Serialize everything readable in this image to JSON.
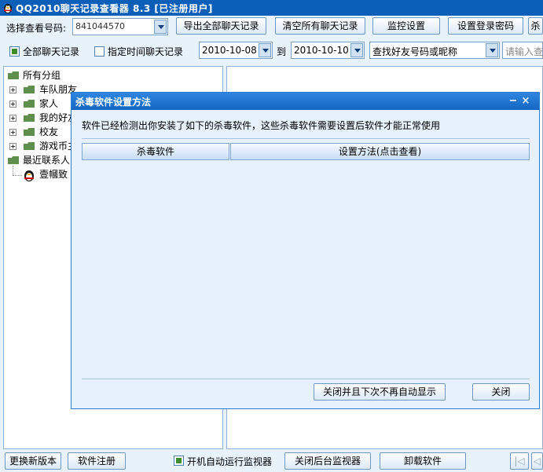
{
  "window": {
    "title": "QQ2010聊天记录查看器 8.3 [已注册用户]",
    "icon": "qq-penguin-icon"
  },
  "toolbar": {
    "account_label": "选择查看号码:",
    "account_value": "841044570",
    "export_all_label": "导出全部聊天记录",
    "clear_all_label": "清空所有聊天记录",
    "monitor_settings_label": "监控设置",
    "set_password_label": "设置登录密码",
    "cutoff_label": "杀"
  },
  "filters": {
    "all_records_label": "全部聊天记录",
    "time_range_label": "指定时间聊天记录",
    "date_from": "2010-10-08",
    "to_label": "到",
    "date_to": "2010-10-10",
    "search_type": "查找好友号码或昵称",
    "search_placeholder": "请输入查"
  },
  "tree": {
    "root_label": "所有分组",
    "groups": [
      {
        "label": "车队朋友"
      },
      {
        "label": "家人"
      },
      {
        "label": "我的好友"
      },
      {
        "label": "校友"
      },
      {
        "label": "游戏币主"
      }
    ],
    "recent_label": "最近联系人",
    "recent_contact": "壹幗致"
  },
  "dialog": {
    "title": "杀毒软件设置方法",
    "message": "软件已经检测出你安装了如下的杀毒软件，这些杀毒软件需要设置后软件才能正常使用",
    "col_antivirus": "杀毒软件",
    "col_method": "设置方法(点击查看)",
    "close_no_show_label": "关闭并且下次不再自动显示",
    "close_label": "关闭",
    "minimize_glyph": "−",
    "close_glyph": "×"
  },
  "bottombar": {
    "update_label": "更换新版本",
    "register_label": "软件注册",
    "autostart_label": "开机自动运行监视器",
    "close_monitor_label": "关闭后台监视器",
    "uninstall_label": "卸载软件",
    "nav_first_glyph": "|◁",
    "nav_prev_glyph": "◁"
  },
  "colors": {
    "titlebar": "#0b5fb8",
    "dialog_titlebar": "#1e78d8",
    "panel_bg": "#e8f2fb",
    "button_border": "#6f97c4"
  }
}
